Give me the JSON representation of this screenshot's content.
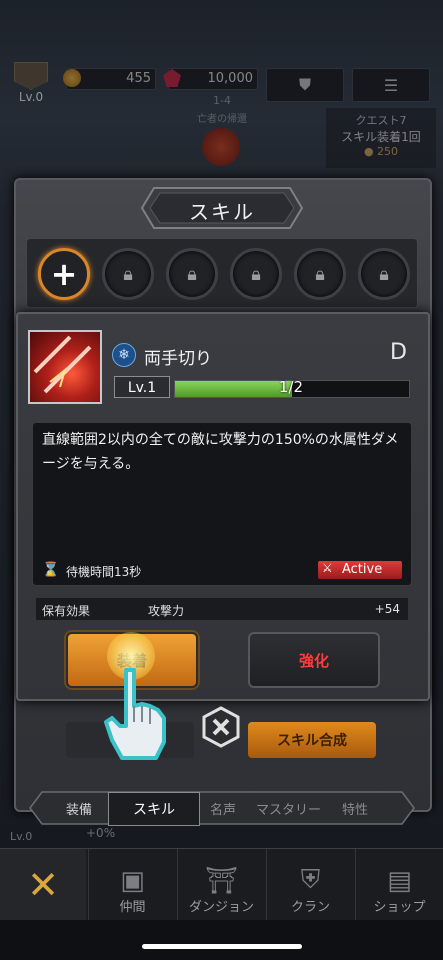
{
  "hud": {
    "level": "Lv.0",
    "gold": "455",
    "gems": "10,000",
    "stage": "1-4",
    "stage_name": "亡者の帰還",
    "quest_label": "クエスト7",
    "quest_text": "スキル装着1回",
    "quest_reward": "250"
  },
  "panel": {
    "title": "スキル",
    "slot_add_symbol": "+",
    "locked_slots": 5
  },
  "skill": {
    "name": "両手切り",
    "grade": "D",
    "level": "Lv.1",
    "exp": "1/2",
    "exp_fraction": 0.5,
    "description": "直線範囲2以内の全ての敵に攻撃力の150%の水属性ダメージを与える。",
    "cooldown": "待機時間13秒",
    "type_badge": "Active",
    "effect_label": "保有効果",
    "effect_stat": "攻撃力",
    "effect_value": "+54",
    "equip_label": "装着",
    "upgrade_label": "強化",
    "bulk_label": "スキル合成"
  },
  "tabs": [
    "装備",
    "スキル",
    "名声",
    "マスタリー",
    "特性"
  ],
  "background_stat": "+0%",
  "background_level": "Lv.0",
  "nav": [
    "仲間",
    "ダンジョン",
    "クラン",
    "ショップ"
  ],
  "colors": {
    "accent_orange": "#e08a1c",
    "exp_green": "#6cc23a",
    "active_red": "#c42a2a",
    "upgrade_text": "#ff3b3b"
  }
}
